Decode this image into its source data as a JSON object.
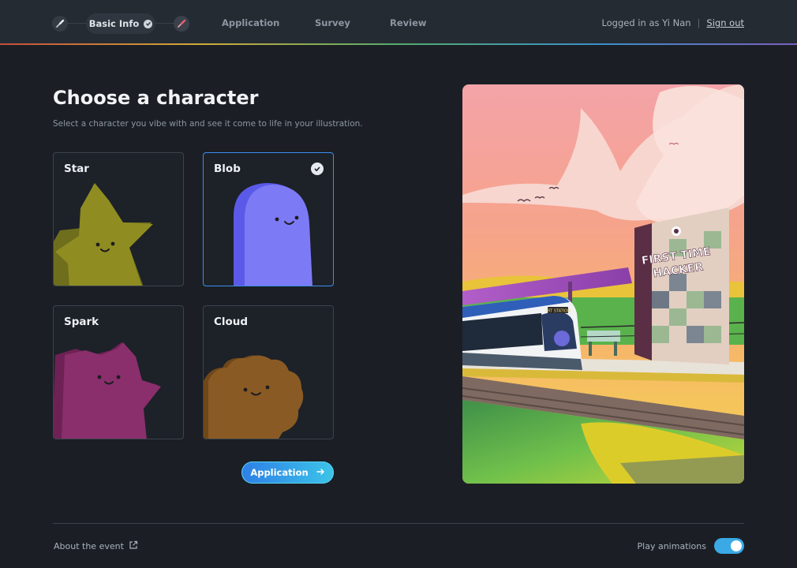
{
  "header": {
    "steps": [
      {
        "label": "Basic Info",
        "state": "completed"
      },
      {
        "label": "Application",
        "state": "upcoming"
      },
      {
        "label": "Survey",
        "state": "upcoming"
      },
      {
        "label": "Review",
        "state": "upcoming"
      }
    ],
    "logged_in_text": "Logged in as Yi Nan",
    "separator": "|",
    "sign_out": "Sign out"
  },
  "main": {
    "title": "Choose a character",
    "subtitle": "Select a character you vibe with and see it come to life in your illustration.",
    "characters": [
      {
        "label": "Star",
        "color": "#8f8c22",
        "selected": false
      },
      {
        "label": "Blob",
        "color": "#7d7af5",
        "selected": true
      },
      {
        "label": "Spark",
        "color": "#8a2f6b",
        "selected": false
      },
      {
        "label": "Cloud",
        "color": "#8a5a24",
        "selected": false
      }
    ],
    "next_button": "Application",
    "next_icon": "arrow-right-icon"
  },
  "illustration": {
    "sign_line1": "FIRST TIME",
    "sign_line2": "HACKER",
    "tram_display": "LRT STATION"
  },
  "footer": {
    "about": "About the event",
    "about_icon": "external-link-icon",
    "play_animations": "Play animations",
    "play_animations_on": true
  },
  "colors": {
    "accent": "#3d8ef0",
    "background": "#1b1f25",
    "header": "#252b33"
  }
}
